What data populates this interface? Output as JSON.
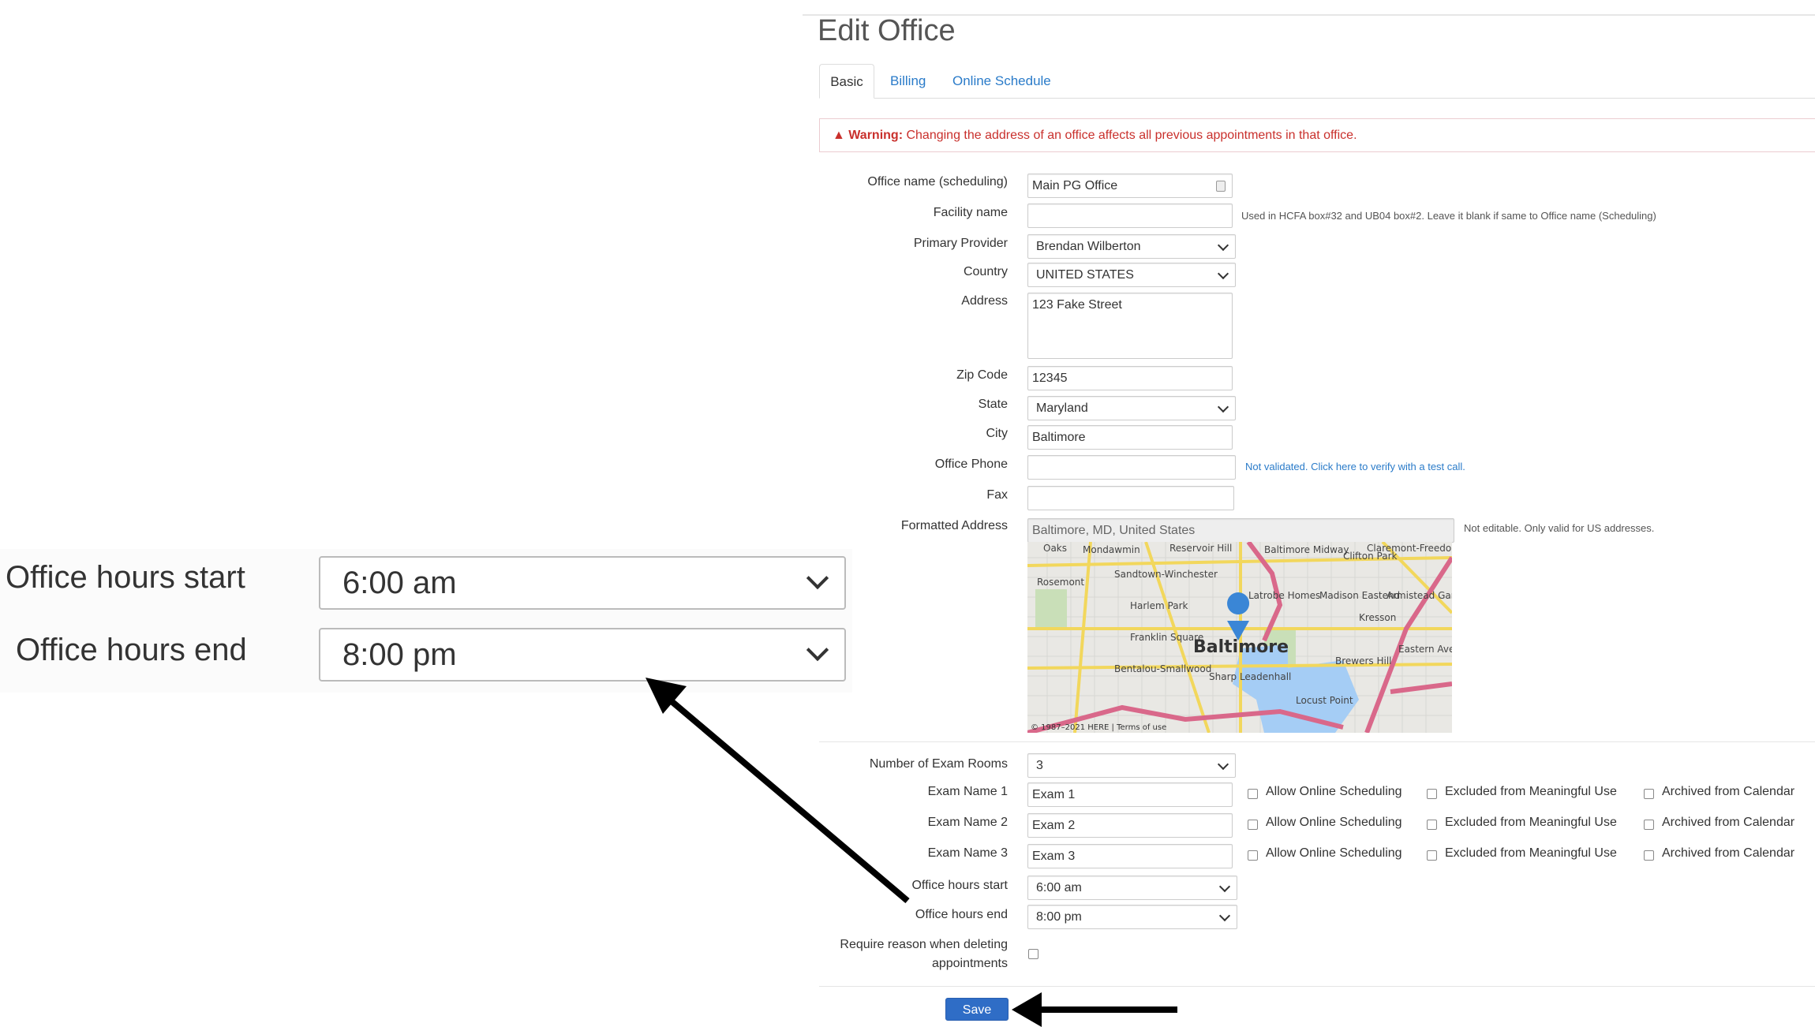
{
  "page": {
    "title": "Edit Office"
  },
  "tabs": [
    {
      "label": "Basic",
      "active": true
    },
    {
      "label": "Billing"
    },
    {
      "label": "Online Schedule"
    }
  ],
  "warning": {
    "strong": "Warning:",
    "text": " Changing the address of an office affects all previous appointments in that office.",
    "icon": "warning-triangle-icon"
  },
  "form": {
    "office_name": {
      "label": "Office name (scheduling)",
      "value": "Main PG Office"
    },
    "facility_name": {
      "label": "Facility name",
      "value": "",
      "help": "Used in HCFA box#32 and UB04 box#2. Leave it blank if same to Office name (Scheduling)"
    },
    "primary_provider": {
      "label": "Primary Provider",
      "value": "Brendan Wilberton"
    },
    "country": {
      "label": "Country",
      "value": "UNITED STATES"
    },
    "address": {
      "label": "Address",
      "value": "123 Fake Street"
    },
    "zip": {
      "label": "Zip Code",
      "value": "12345"
    },
    "state": {
      "label": "State",
      "value": "Maryland"
    },
    "city": {
      "label": "City",
      "value": "Baltimore"
    },
    "phone": {
      "label": "Office Phone",
      "value": "",
      "help": "Not validated. Click here to verify with a test call."
    },
    "fax": {
      "label": "Fax",
      "value": ""
    },
    "formatted_address": {
      "label": "Formatted Address",
      "value": "Baltimore, MD, United States",
      "help": "Not editable. Only valid for US addresses."
    },
    "exam_rooms": {
      "label": "Number of Exam Rooms",
      "value": "3"
    },
    "exams": [
      {
        "label": "Exam Name 1",
        "value": "Exam 1"
      },
      {
        "label": "Exam Name 2",
        "value": "Exam 2"
      },
      {
        "label": "Exam Name 3",
        "value": "Exam 3"
      }
    ],
    "exam_options": {
      "online": "Allow Online Scheduling",
      "meaningful": "Excluded from Meaningful Use",
      "archived": "Archived from Calendar"
    },
    "hours_start": {
      "label": "Office hours start",
      "value": "6:00 am"
    },
    "hours_end": {
      "label": "Office hours end",
      "value": "8:00 pm"
    },
    "require_reason": {
      "label1": "Require reason when deleting",
      "label2": "appointments",
      "checked": false
    },
    "save": "Save"
  },
  "map": {
    "city": "Baltimore",
    "labels": [
      "Oaks",
      "Mondawmin",
      "Reservoir Hill",
      "Baltimore Midway",
      "Clifton Park",
      "Claremont-Freedom",
      "Rosemont",
      "Sandtown-Winchester",
      "Harlem Park",
      "Latrobe Homes",
      "Madison Eastend",
      "Armistead Gardens",
      "Kresson",
      "Franklin Square",
      "Bentalou-Smallwood",
      "Sharp Leadenhall",
      "Brewers Hill",
      "Locust Point",
      "Eastern Ave"
    ],
    "copyright": "© 1987–2021 HERE | Terms of use",
    "colors": {
      "water": "#a5cdf5",
      "highway": "#d9688a",
      "road": "#f2d75c",
      "land": "#e9e8e4",
      "park": "#c9dfb8",
      "pin": "#3a86d6"
    }
  },
  "colors": {
    "link": "#2a7bc9",
    "warning": "#c9302c",
    "primary": "#2f6dc6"
  }
}
